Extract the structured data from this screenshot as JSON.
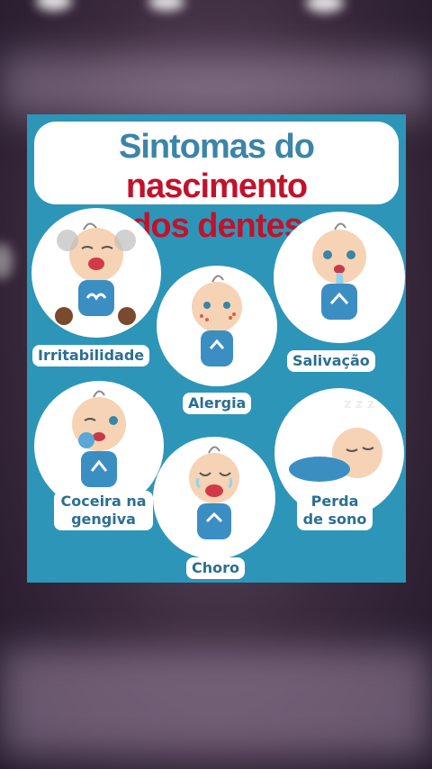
{
  "title": {
    "part1": "Sintomas do",
    "part2": "nascimento",
    "part3": "dos dentes"
  },
  "symptoms": [
    {
      "label": "Irritabilidade"
    },
    {
      "label": "Alergia"
    },
    {
      "label": "Salivação"
    },
    {
      "label": "Coceira na gengiva"
    },
    {
      "label": "Choro"
    },
    {
      "label": "Perda de sono"
    }
  ],
  "sleep_text": "z z z",
  "colors": {
    "card_bg": "#2d95b8",
    "title_blue": "#3c84a8",
    "title_red": "#c2122a",
    "label_text": "#2a6f92",
    "baby_skin": "#f6d3b4",
    "baby_shirt": "#3b8ec2"
  }
}
